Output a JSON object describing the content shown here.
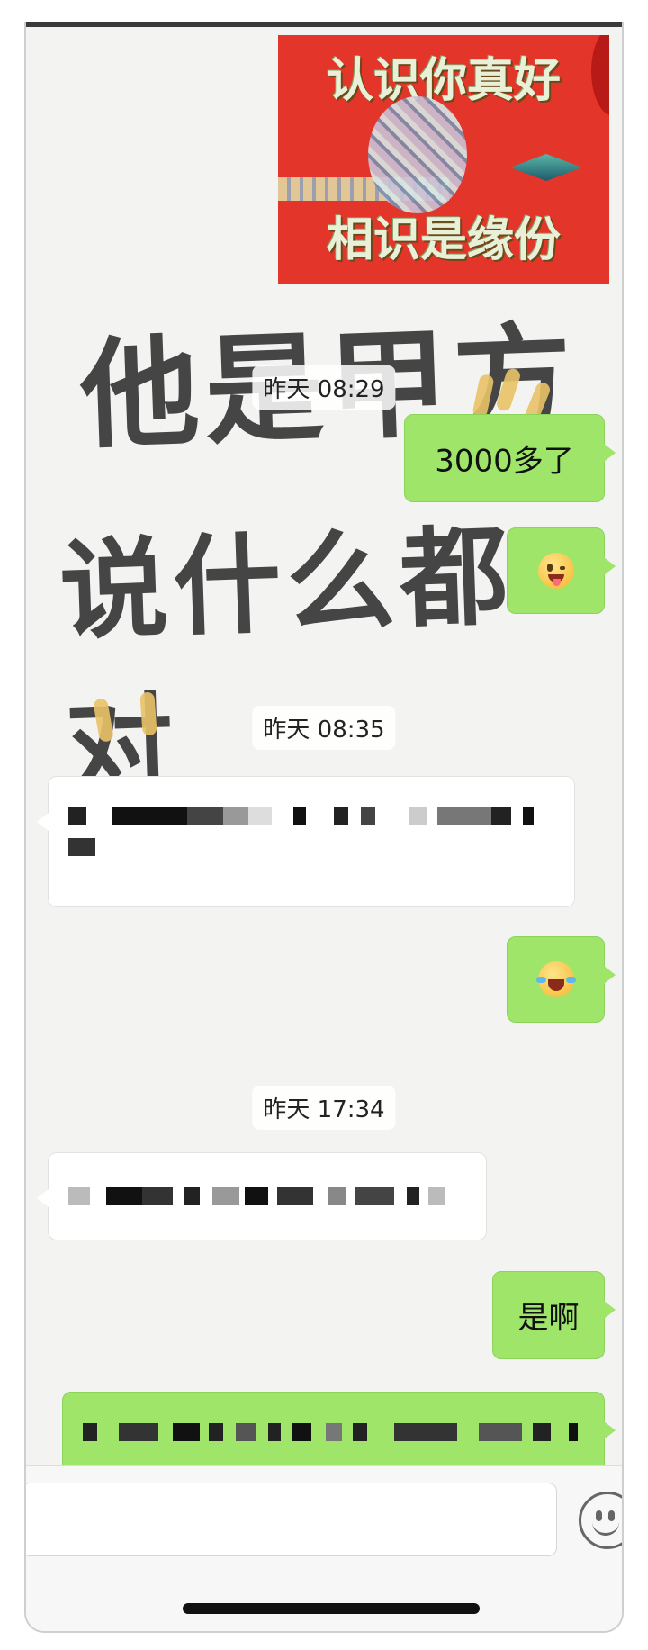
{
  "sticker": {
    "title_top": "认识你真好",
    "title_bottom": "相识是缘份"
  },
  "wallpaper": {
    "line1": "他是甲方",
    "line2": "说什么都对"
  },
  "messages": [
    {
      "type": "time",
      "text": "昨天 08:29"
    },
    {
      "type": "text",
      "side": "right",
      "text": "3000多了"
    },
    {
      "type": "emoji",
      "side": "right",
      "icon": "winking-tongue-emoji-icon"
    },
    {
      "type": "time",
      "text": "昨天 08:35"
    },
    {
      "type": "pixelated",
      "side": "left"
    },
    {
      "type": "emoji",
      "side": "right",
      "icon": "laughing-crying-emoji-icon"
    },
    {
      "type": "time",
      "text": "昨天 17:34"
    },
    {
      "type": "pixelated",
      "side": "left"
    },
    {
      "type": "text",
      "side": "right",
      "text": "是啊"
    },
    {
      "type": "pixelated",
      "side": "right"
    }
  ],
  "input": {
    "placeholder": ""
  },
  "icons": {
    "emoji_button": "smile-face-icon"
  },
  "colors": {
    "bubble_outgoing": "#9ee56a",
    "bubble_incoming": "#ffffff",
    "chat_background": "#f3f3f1",
    "sticker_red": "#e4352a"
  }
}
